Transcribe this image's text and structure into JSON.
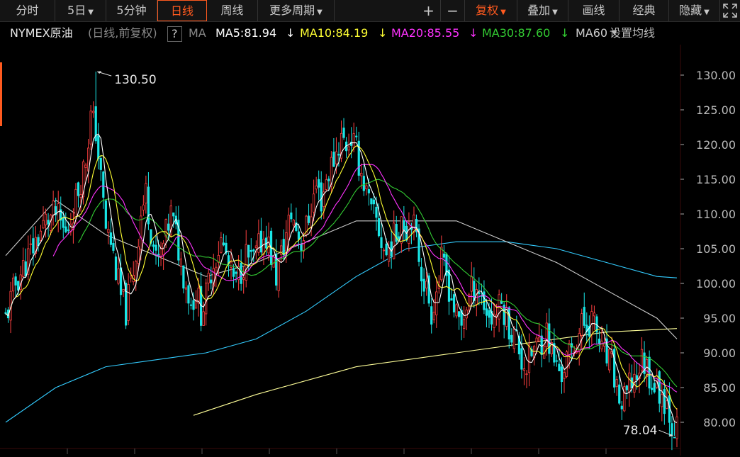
{
  "toolbar": {
    "tabs": [
      "分时",
      "5日",
      "5分钟",
      "日线",
      "周线",
      "更多周期"
    ],
    "active_tab": "日线",
    "zoom_in": "+",
    "zoom_out": "−",
    "fuquan": "复权",
    "diejia": "叠加",
    "huaxian": "画线",
    "jingdian": "经典",
    "yincang": "隐藏"
  },
  "legend": {
    "symbol": "NYMEX原油",
    "mode": "(日线,前复权)",
    "help": "?",
    "ma_label": "MA",
    "ma5": "MA5:81.94",
    "ma10": "MA10:84.19",
    "ma20": "MA20:85.55",
    "ma30": "MA30:87.60",
    "ma60": "MA60",
    "settings": "设置均线"
  },
  "colors": {
    "up": "#ff4040",
    "down": "#19e6e6",
    "ma5": "#ffffff",
    "ma10": "#ffff33",
    "ma20": "#ff33ff",
    "ma30": "#33cc33",
    "ma60": "#cccccc",
    "ma120": "#33ccff",
    "ma250": "#ffff99",
    "grid": "#2a0000",
    "accent": "#ff5a1f"
  },
  "chart_data": {
    "type": "candlestick",
    "title": "NYMEX原油 日线 前复权",
    "ylim": [
      77,
      134
    ],
    "yticks": [
      "130.00",
      "125.00",
      "120.00",
      "115.00",
      "110.00",
      "105.00",
      "100.00",
      "95.00",
      "90.00",
      "85.00",
      "80.00"
    ],
    "high_label": "130.50",
    "low_label": "78.04",
    "high": 130.5,
    "low": 78.04,
    "ma_last": {
      "MA5": 81.94,
      "MA10": 84.19,
      "MA20": 85.55,
      "MA30": 87.6
    },
    "close_path": [
      [
        0,
        95
      ],
      [
        4,
        100
      ],
      [
        8,
        103
      ],
      [
        12,
        106
      ],
      [
        16,
        109
      ],
      [
        20,
        110
      ],
      [
        24,
        107
      ],
      [
        28,
        112
      ],
      [
        32,
        118
      ],
      [
        34,
        124
      ],
      [
        36,
        122
      ],
      [
        38,
        115
      ],
      [
        40,
        108
      ],
      [
        42,
        106
      ],
      [
        44,
        102
      ],
      [
        46,
        98
      ],
      [
        48,
        96
      ],
      [
        50,
        100
      ],
      [
        52,
        104
      ],
      [
        54,
        110
      ],
      [
        56,
        113
      ],
      [
        58,
        108
      ],
      [
        60,
        103
      ],
      [
        62,
        104
      ],
      [
        64,
        107
      ],
      [
        66,
        110
      ],
      [
        68,
        107
      ],
      [
        70,
        103
      ],
      [
        72,
        100
      ],
      [
        74,
        97
      ],
      [
        76,
        99
      ],
      [
        78,
        96
      ],
      [
        80,
        98
      ],
      [
        82,
        102
      ],
      [
        84,
        104
      ],
      [
        86,
        106
      ],
      [
        88,
        104
      ],
      [
        90,
        101
      ],
      [
        92,
        100
      ],
      [
        94,
        102
      ],
      [
        96,
        104
      ],
      [
        98,
        103
      ],
      [
        100,
        104
      ],
      [
        102,
        106
      ],
      [
        104,
        107
      ],
      [
        106,
        104
      ],
      [
        108,
        101
      ],
      [
        110,
        104
      ],
      [
        112,
        107
      ],
      [
        114,
        110
      ],
      [
        116,
        108
      ],
      [
        118,
        106
      ],
      [
        120,
        108
      ],
      [
        122,
        111
      ],
      [
        124,
        114
      ],
      [
        126,
        112
      ],
      [
        128,
        115
      ],
      [
        130,
        117
      ],
      [
        132,
        119
      ],
      [
        134,
        121
      ],
      [
        136,
        120
      ],
      [
        138,
        121
      ],
      [
        140,
        119
      ],
      [
        142,
        116
      ],
      [
        144,
        113
      ],
      [
        146,
        110
      ],
      [
        148,
        109
      ],
      [
        150,
        106
      ],
      [
        152,
        104
      ],
      [
        154,
        106
      ],
      [
        156,
        107
      ],
      [
        158,
        110
      ],
      [
        160,
        108
      ],
      [
        162,
        110
      ],
      [
        164,
        106
      ],
      [
        166,
        102
      ],
      [
        168,
        99
      ],
      [
        170,
        96
      ],
      [
        172,
        99
      ],
      [
        174,
        103
      ],
      [
        176,
        101
      ],
      [
        178,
        98
      ],
      [
        180,
        95
      ],
      [
        182,
        94
      ],
      [
        184,
        97
      ],
      [
        186,
        99
      ],
      [
        188,
        100
      ],
      [
        190,
        98
      ],
      [
        192,
        96
      ],
      [
        194,
        95
      ],
      [
        196,
        96
      ],
      [
        198,
        97
      ],
      [
        200,
        95
      ],
      [
        202,
        93
      ],
      [
        204,
        92
      ],
      [
        206,
        89
      ],
      [
        208,
        88
      ],
      [
        210,
        90
      ],
      [
        212,
        91
      ],
      [
        214,
        92
      ],
      [
        216,
        93
      ],
      [
        218,
        90
      ],
      [
        220,
        88
      ],
      [
        222,
        87
      ],
      [
        224,
        89
      ],
      [
        226,
        90
      ],
      [
        228,
        92
      ],
      [
        230,
        94
      ],
      [
        232,
        94
      ],
      [
        234,
        95
      ],
      [
        236,
        93
      ],
      [
        238,
        90
      ],
      [
        240,
        89
      ],
      [
        242,
        88
      ],
      [
        244,
        85
      ],
      [
        246,
        82
      ],
      [
        248,
        84
      ],
      [
        250,
        86
      ],
      [
        252,
        87
      ],
      [
        254,
        89
      ],
      [
        256,
        88
      ],
      [
        258,
        86
      ],
      [
        260,
        85
      ],
      [
        262,
        84
      ],
      [
        264,
        83
      ],
      [
        266,
        80
      ],
      [
        268,
        79
      ]
    ],
    "ma_paths": {
      "MA60": [
        [
          0,
          104
        ],
        [
          20,
          112
        ],
        [
          40,
          107
        ],
        [
          60,
          104
        ],
        [
          80,
          101
        ],
        [
          100,
          103
        ],
        [
          120,
          106
        ],
        [
          140,
          109
        ],
        [
          160,
          109
        ],
        [
          180,
          109
        ],
        [
          200,
          106
        ],
        [
          220,
          103
        ],
        [
          240,
          99
        ],
        [
          260,
          95
        ],
        [
          268,
          92
        ]
      ],
      "MA120": [
        [
          0,
          80
        ],
        [
          20,
          85
        ],
        [
          40,
          88
        ],
        [
          60,
          89
        ],
        [
          80,
          90
        ],
        [
          100,
          92
        ],
        [
          120,
          96
        ],
        [
          140,
          101
        ],
        [
          160,
          105
        ],
        [
          180,
          106
        ],
        [
          200,
          106
        ],
        [
          220,
          105
        ],
        [
          240,
          103
        ],
        [
          260,
          101
        ],
        [
          268,
          100.8
        ]
      ],
      "MA250": [
        [
          75,
          81
        ],
        [
          100,
          84
        ],
        [
          140,
          88
        ],
        [
          180,
          90
        ],
        [
          210,
          91.5
        ],
        [
          240,
          93
        ],
        [
          268,
          93.5
        ]
      ]
    }
  }
}
